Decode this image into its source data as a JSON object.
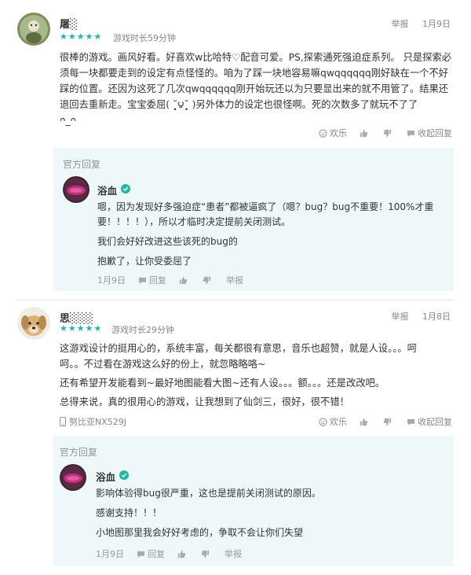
{
  "reviews": [
    {
      "username": "屠░",
      "report": "举报",
      "date": "1月9日",
      "stars": "★★★★★",
      "rating": 5,
      "playtime": "游戏时长59分钟",
      "text": [
        "很棒的游戏。画风好看。好喜欢w比哈特♡配音可爱。PS,探索通死强迫症系列。 只是探索必",
        "须每一块都要走到的设定有点怪怪的。咱为了踩一块地容易嘛qwqqqqqq刚好缺在一个不好",
        "踩的位置。还因为这死了几次qwqqqqqq刚开始玩还以为只要显出来的就不用管了。结果还",
        "退回去重新走。宝宝委屈( ˘̩̥̩౪˘̩̥̩ )另外体力的设定也很怪啊。死的次数多了就玩不了了",
        "ᴖ_ᴖ"
      ],
      "actions": {
        "funny": "欢乐",
        "collapse": "收起回复"
      },
      "reply": {
        "label": "官方回复",
        "name": "浴血",
        "text": [
          "嗯，因为发现好多强迫症“患者”都被逼疯了（嗯？bug？bug不重要！100%才重",
          "要！！！！），所以才临时决定提前关闭测试。",
          "我们会好好改进这些该死的bug的",
          "抱歉了，让你受委屈了"
        ],
        "date": "1月9日",
        "reply_btn": "回复",
        "report": "举报"
      }
    },
    {
      "username": "思░░░",
      "report": "举报",
      "date": "1月8日",
      "stars": "★★★★★",
      "rating": 5,
      "playtime": "游戏时长29分钟",
      "text": [
        "这游戏设计的挺用心的，系统丰富，每关都很有意思，音乐也超赞，就是人设。。。呵",
        "呵。。不过看在游戏这么好的份上，就忽略略咯~",
        "还有希望开发能看到~最好地图能看大图~还有人设。。。额。。。还是改改吧。",
        "总得来说，真的很用心的游戏，让我想到了仙剑三，很好，很不错！"
      ],
      "device": "努比亚NX529J",
      "actions": {
        "funny": "欢乐",
        "collapse": "收起回复"
      },
      "reply": {
        "label": "官方回复",
        "name": "浴血",
        "text": [
          "影响体验得bug很严重，这也是提前关闭测试的原因。",
          "感谢支持！！！",
          "小地图那里我会好好考虑的，争取不会让你们失望"
        ],
        "date": "1月9日",
        "reply_btn": "回复",
        "report": "举报"
      }
    }
  ],
  "colors": {
    "accent": "#1fb8a4",
    "reply_bg": "#eef8f9",
    "verified": "#1fb8a4"
  }
}
